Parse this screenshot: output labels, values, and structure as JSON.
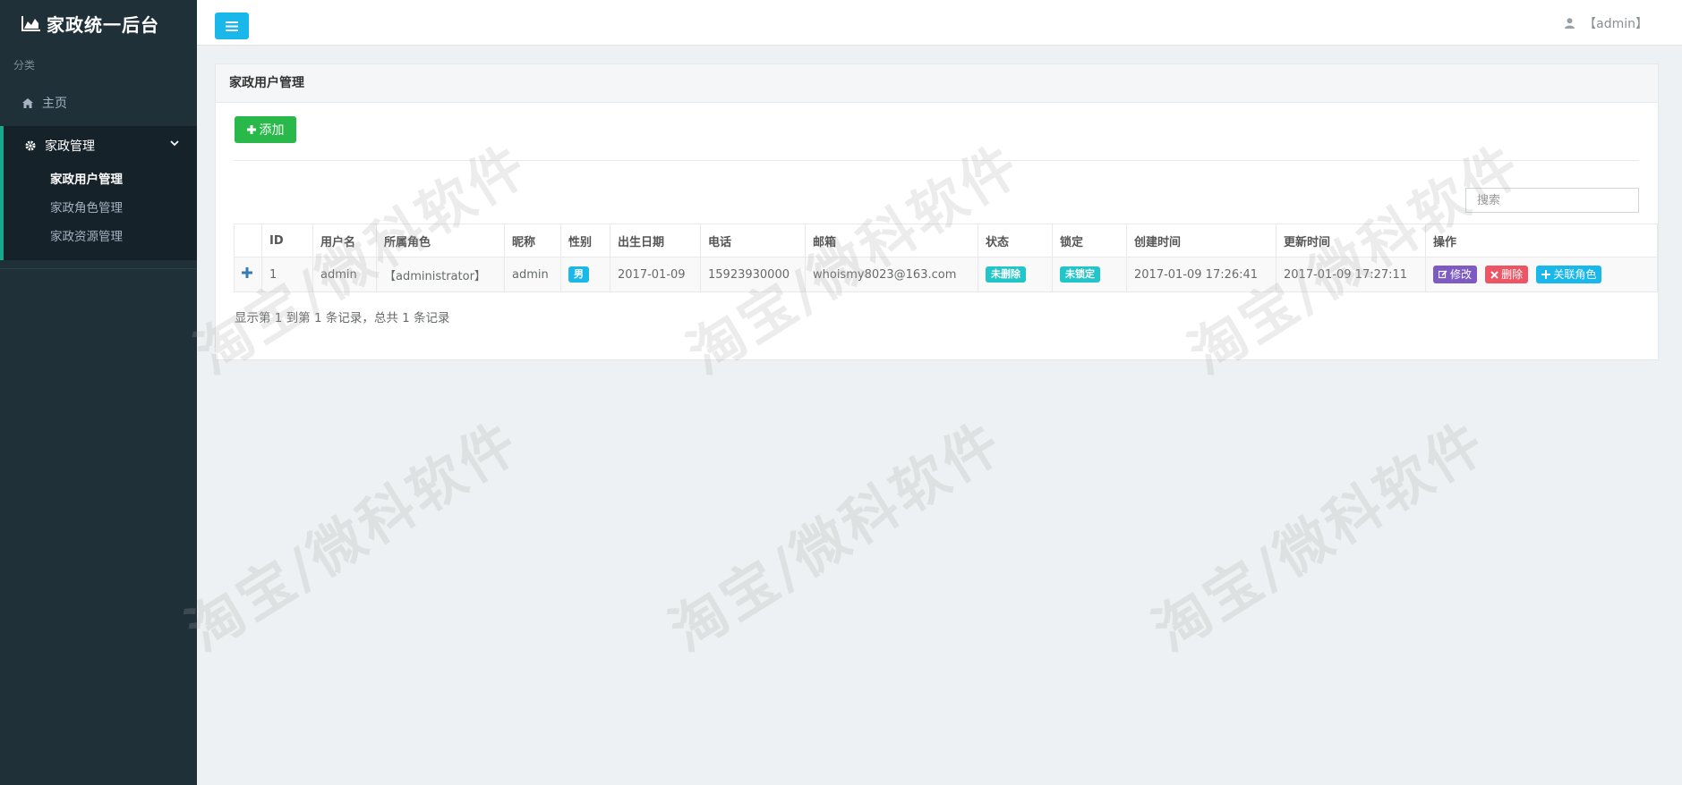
{
  "brand": {
    "title": "家政统一后台",
    "icon": "area-chart-icon"
  },
  "sidebar": {
    "category_label": "分类",
    "home_label": "主页",
    "group": {
      "label": "家政管理",
      "items": [
        {
          "label": "家政用户管理",
          "active": true
        },
        {
          "label": "家政角色管理",
          "active": false
        },
        {
          "label": "家政资源管理",
          "active": false
        }
      ]
    }
  },
  "topbar": {
    "user_label": "【admin】"
  },
  "panel": {
    "title": "家政用户管理",
    "add_label": "添加",
    "search_placeholder": "搜索",
    "columns": [
      "ID",
      "用户名",
      "所属角色",
      "昵称",
      "性别",
      "出生日期",
      "电话",
      "邮箱",
      "状态",
      "锁定",
      "创建时间",
      "更新时间",
      "操作"
    ],
    "rows": [
      {
        "id": "1",
        "username": "admin",
        "role": "【administrator】",
        "nickname": "admin",
        "gender": "男",
        "birthday": "2017-01-09",
        "phone": "15923930000",
        "email": "whoismy8023@163.com",
        "status": "未删除",
        "lock": "未锁定",
        "created": "2017-01-09 17:26:41",
        "updated": "2017-01-09 17:27:11",
        "actions": {
          "edit": "修改",
          "delete": "删除",
          "link_role": "关联角色"
        }
      }
    ],
    "pagination_info": "显示第 1 到第 1 条记录，总共 1 条记录"
  },
  "watermark": "淘宝/微科软件",
  "colors": {
    "sidebar_bg": "#203039",
    "accent_blue": "#1ab7ea",
    "success_green": "#29b94a",
    "teal": "#23c6c8",
    "purple": "#7c5cc4",
    "danger": "#ed5565"
  }
}
